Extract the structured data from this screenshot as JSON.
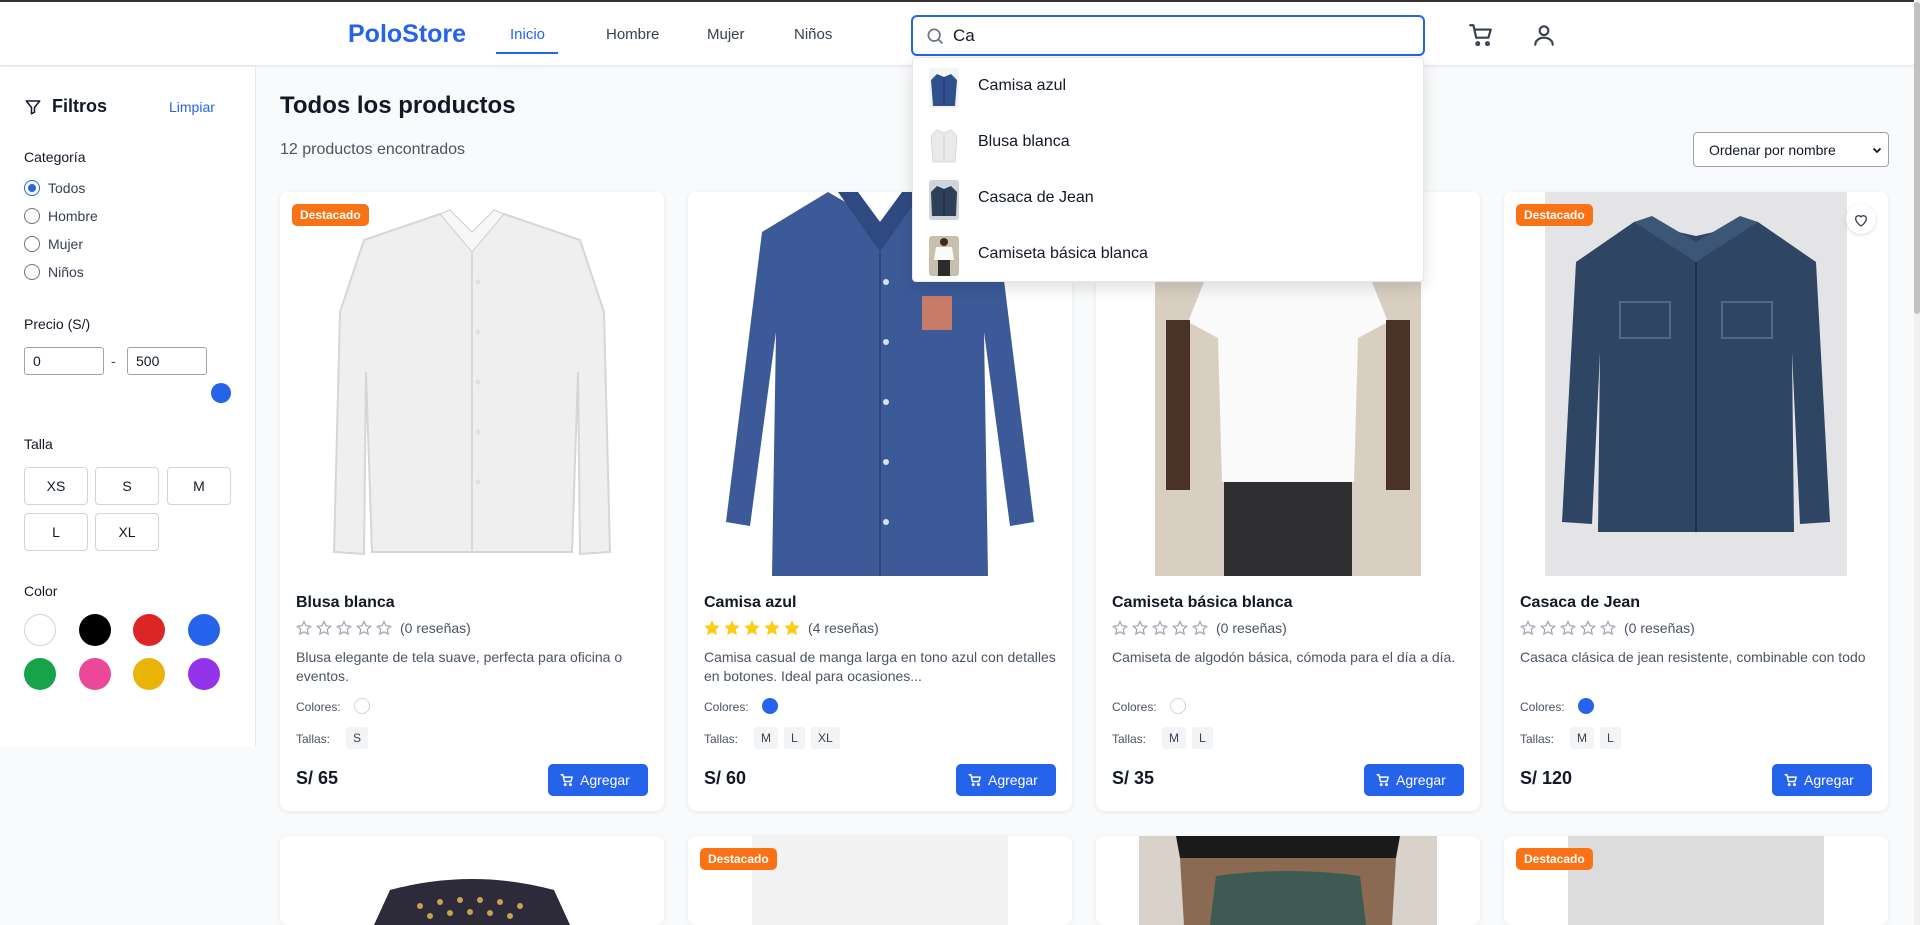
{
  "header": {
    "logo": "PoloStore",
    "nav": [
      {
        "label": "Inicio",
        "active": true
      },
      {
        "label": "Hombre",
        "active": false
      },
      {
        "label": "Mujer",
        "active": false
      },
      {
        "label": "Niños",
        "active": false
      }
    ],
    "search": {
      "value": "Ca"
    },
    "icons": [
      "cart-icon",
      "user-icon"
    ]
  },
  "search_suggestions": [
    {
      "label": "Camisa azul",
      "thumb_color": "#2f4f8f"
    },
    {
      "label": "Blusa blanca",
      "thumb_color": "#e5e7eb"
    },
    {
      "label": "Casaca de Jean",
      "thumb_color": "#2d4056"
    },
    {
      "label": "Camiseta básica blanca",
      "thumb_color": "#b9ad9c"
    }
  ],
  "sidebar": {
    "title": "Filtros",
    "clear_label": "Limpiar",
    "category": {
      "title": "Categoría",
      "options": [
        {
          "label": "Todos",
          "checked": true
        },
        {
          "label": "Hombre",
          "checked": false
        },
        {
          "label": "Mujer",
          "checked": false
        },
        {
          "label": "Niños",
          "checked": false
        }
      ]
    },
    "price": {
      "title": "Precio (S/)",
      "min": "0",
      "max": "500",
      "separator": "-"
    },
    "sizes": {
      "title": "Talla",
      "options": [
        "XS",
        "S",
        "M",
        "L",
        "XL"
      ]
    },
    "colors": {
      "title": "Color",
      "options": [
        "#ffffff",
        "#000000",
        "#dc2626",
        "#2563eb",
        "#16a34a",
        "#ec4899",
        "#eab308",
        "#9333ea"
      ]
    }
  },
  "main": {
    "title": "Todos los productos",
    "count": "12 productos encontrados",
    "sort": "Ordenar por nombre"
  },
  "products": [
    {
      "name": "Blusa blanca",
      "featured": true,
      "badge": "Destacado",
      "rating": 0,
      "reviews": "(0 reseñas)",
      "desc": "Blusa elegante de tela suave, perfecta para oficina o eventos.",
      "colors_label": "Colores:",
      "colors": [
        "#ffffff"
      ],
      "sizes_label": "Tallas:",
      "sizes": [
        "S"
      ],
      "price": "S/ 65",
      "button": "Agregar",
      "favorite_visible": false
    },
    {
      "name": "Camisa azul",
      "featured": false,
      "badge": "",
      "rating": 5,
      "reviews": "(4 reseñas)",
      "desc": "Camisa casual de manga larga en tono azul con detalles en botones. Ideal para ocasiones...",
      "colors_label": "Colores:",
      "colors": [
        "#2563eb"
      ],
      "sizes_label": "Tallas:",
      "sizes": [
        "M",
        "L",
        "XL"
      ],
      "price": "S/ 60",
      "button": "Agregar",
      "favorite_visible": false
    },
    {
      "name": "Camiseta básica blanca",
      "featured": false,
      "badge": "",
      "rating": 0,
      "reviews": "(0 reseñas)",
      "desc": "Camiseta de algodón básica, cómoda para el día a día.",
      "colors_label": "Colores:",
      "colors": [
        "#ffffff"
      ],
      "sizes_label": "Tallas:",
      "sizes": [
        "M",
        "L"
      ],
      "price": "S/ 35",
      "button": "Agregar",
      "favorite_visible": false
    },
    {
      "name": "Casaca de Jean",
      "featured": true,
      "badge": "Destacado",
      "rating": 0,
      "reviews": "(0 reseñas)",
      "desc": "Casaca clásica de jean resistente, combinable con todo",
      "colors_label": "Colores:",
      "colors": [
        "#2563eb"
      ],
      "sizes_label": "Tallas:",
      "sizes": [
        "M",
        "L"
      ],
      "price": "S/ 120",
      "button": "Agregar",
      "favorite_visible": true
    }
  ],
  "second_row": [
    {
      "featured": false,
      "badge": ""
    },
    {
      "featured": true,
      "badge": "Destacado"
    },
    {
      "featured": false,
      "badge": ""
    },
    {
      "featured": true,
      "badge": "Destacado"
    }
  ]
}
